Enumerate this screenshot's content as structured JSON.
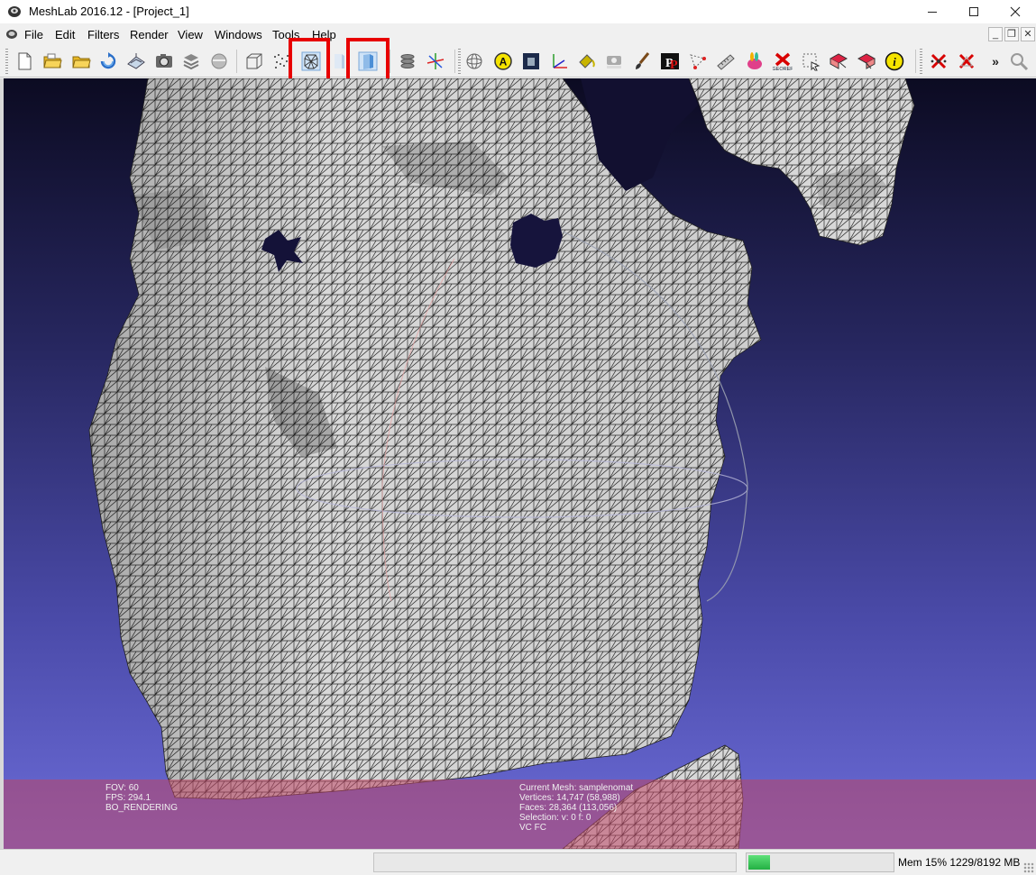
{
  "window": {
    "title": "MeshLab 2016.12 - [Project_1]",
    "minimize_icon": "minimize-icon",
    "maximize_icon": "maximize-icon",
    "close_icon": "close-icon"
  },
  "menu": {
    "items": [
      "File",
      "Edit",
      "Filters",
      "Render",
      "View",
      "Windows",
      "Tools",
      "Help"
    ]
  },
  "toolbar": {
    "buttons": [
      "new-project-icon",
      "open-project-icon",
      "open-mesh-icon",
      "reload-icon",
      "export-mesh-icon",
      "snapshot-icon",
      "layers-icon",
      "info-icon",
      "bounding-box-icon",
      "points-icon",
      "wireframe-icon",
      "flat-shading-icon",
      "smooth-shading-icon",
      "layer-stack-icon",
      "axis-gizmo-icon",
      "trackball-icon",
      "annotation-icon",
      "raster-icon",
      "axes-icon",
      "paint-pot-icon",
      "camera-align-icon",
      "paintbrush-icon",
      "pickpoints-icon",
      "select-vertex-icon",
      "measure-icon",
      "bunny-color-icon",
      "georef-icon",
      "select-faces-icon",
      "select-area-icon",
      "select-conn-icon",
      "about-icon",
      "delete-vertices-icon",
      "delete-faces-icon",
      "overflow-icon",
      "search-icon"
    ],
    "highlighted": [
      "wireframe-icon",
      "smooth-shading-icon"
    ]
  },
  "viewport": {
    "info_left": [
      "FOV: 60",
      "FPS:   294.1",
      "BO_RENDERING"
    ],
    "info_right": [
      "Current Mesh: samplenomat",
      "Vertices: 14,747     (58,988)",
      "Faces: 28,364     (113,056)",
      "Selection: v: 0 f: 0",
      "VC FC"
    ]
  },
  "status": {
    "progress": 0.15,
    "mem_label": "Mem 15% 1229/8192 MB"
  },
  "colors": {
    "highlight": "#e80000",
    "viewport_top": "#0c0b22",
    "viewport_bottom": "#6c6cd8",
    "mesh": "#d8d8d8"
  }
}
